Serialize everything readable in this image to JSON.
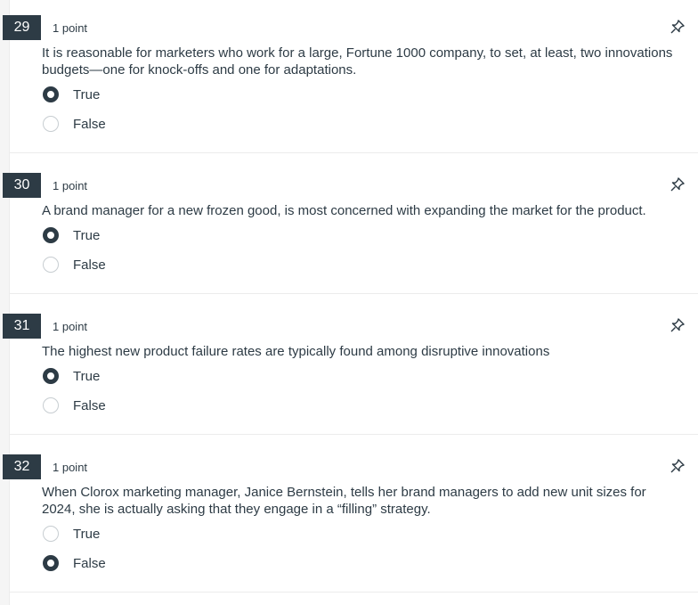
{
  "questions": [
    {
      "number": "29",
      "points": "1 point",
      "text": "It is reasonable for marketers who work for a large, Fortune 1000 company, to set, at least, two innovations budgets—one for knock-offs and one for adaptations.",
      "options": [
        {
          "label": "True",
          "selected": true
        },
        {
          "label": "False",
          "selected": false
        }
      ]
    },
    {
      "number": "30",
      "points": "1 point",
      "text": "A brand manager for a new frozen good, is most concerned with expanding the market for the product.",
      "options": [
        {
          "label": "True",
          "selected": true
        },
        {
          "label": "False",
          "selected": false
        }
      ]
    },
    {
      "number": "31",
      "points": "1 point",
      "text": "The highest new product failure rates are typically found among disruptive innovations",
      "options": [
        {
          "label": "True",
          "selected": true
        },
        {
          "label": "False",
          "selected": false
        }
      ]
    },
    {
      "number": "32",
      "points": "1 point",
      "text": "When Clorox marketing manager, Janice Bernstein, tells her brand managers to add new unit sizes for 2024, she is actually asking that they engage in a “filling” strategy.",
      "options": [
        {
          "label": "True",
          "selected": false
        },
        {
          "label": "False",
          "selected": true
        }
      ]
    }
  ],
  "icons": {
    "pin": "pin-icon"
  },
  "colors": {
    "badge": "#2d3b45",
    "text": "#2d3b45",
    "radio_border": "#c7cdd1"
  }
}
